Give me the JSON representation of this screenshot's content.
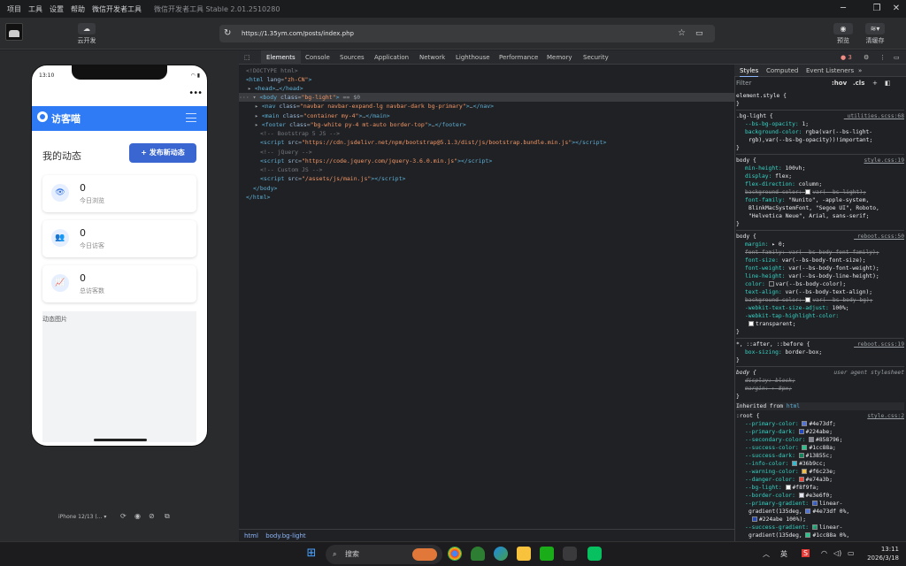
{
  "menubar": {
    "items": [
      "项目",
      "工具",
      "设置",
      "帮助",
      "微信开发者工具"
    ],
    "title": "微信开发者工具 Stable 2.01.2510280"
  },
  "toolbar": {
    "cloud_label": "云开发",
    "url": "https://1.35ym.com/posts/index.php",
    "preview_label": "预览",
    "cache_label": "清缓存"
  },
  "phone": {
    "time": "13:10",
    "brand": "访客喵",
    "page_title": "我的动态",
    "publish_label": "+ 发布新动态",
    "cards": [
      {
        "value": "0",
        "label": "今日浏览",
        "icon": "eye-icon"
      },
      {
        "value": "0",
        "label": "今日访客",
        "icon": "users-icon"
      },
      {
        "value": "0",
        "label": "总访客数",
        "icon": "chart-icon"
      }
    ],
    "image_alt": "动态图片",
    "device": "iPhone 12/13 (... ▾"
  },
  "devtools": {
    "tabs": [
      "Elements",
      "Console",
      "Sources",
      "Application",
      "Network",
      "Lighthouse",
      "Performance",
      "Memory",
      "Security"
    ],
    "error_count": "3",
    "breadcrumb": [
      "html",
      "body.bg-light"
    ]
  },
  "styles": {
    "tabs": [
      "Styles",
      "Computed",
      "Event Listeners",
      "»"
    ],
    "filter_placeholder": "Filter",
    "hov": ":hov",
    "cls": ".cls"
  },
  "taskbar": {
    "search_label": "搜索",
    "lang": "英",
    "time": "13:11",
    "date": "2026/3/18"
  }
}
